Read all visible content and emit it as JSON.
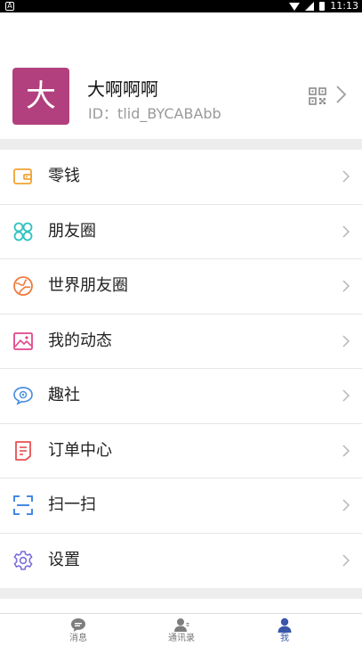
{
  "status_bar": {
    "app_badge": "A",
    "time": "11:13"
  },
  "profile": {
    "avatar_text": "大",
    "name": "大啊啊啊",
    "id_text": "ID：tlid_BYCABAbb"
  },
  "menu": {
    "items": [
      {
        "key": "wallet",
        "label": "零钱",
        "icon": "wallet-icon",
        "color": "#f0a232"
      },
      {
        "key": "moments",
        "label": "朋友圈",
        "icon": "four-circles-icon",
        "color": "#30c2c0"
      },
      {
        "key": "world-moments",
        "label": "世界朋友圈",
        "icon": "globe-icon",
        "color": "#f07a3c"
      },
      {
        "key": "my-posts",
        "label": "我的动态",
        "icon": "image-icon",
        "color": "#e0468a"
      },
      {
        "key": "community",
        "label": "趣社",
        "icon": "chat-bubble-icon",
        "color": "#4a90e2"
      },
      {
        "key": "orders",
        "label": "订单中心",
        "icon": "document-icon",
        "color": "#e85050"
      },
      {
        "key": "scan",
        "label": "扫一扫",
        "icon": "scan-icon",
        "color": "#2f7be0"
      },
      {
        "key": "settings",
        "label": "设置",
        "icon": "gear-icon",
        "color": "#7b6cd9"
      }
    ]
  },
  "tabbar": {
    "tabs": [
      {
        "key": "messages",
        "label": "消息",
        "icon": "message-icon",
        "active": false
      },
      {
        "key": "contacts",
        "label": "通讯录",
        "icon": "contacts-icon",
        "active": false
      },
      {
        "key": "me",
        "label": "我",
        "icon": "person-icon",
        "active": true
      }
    ]
  },
  "colors": {
    "avatar_bg": "#b2407e",
    "active_tab": "#3a56a8",
    "divider": "#ededed"
  }
}
